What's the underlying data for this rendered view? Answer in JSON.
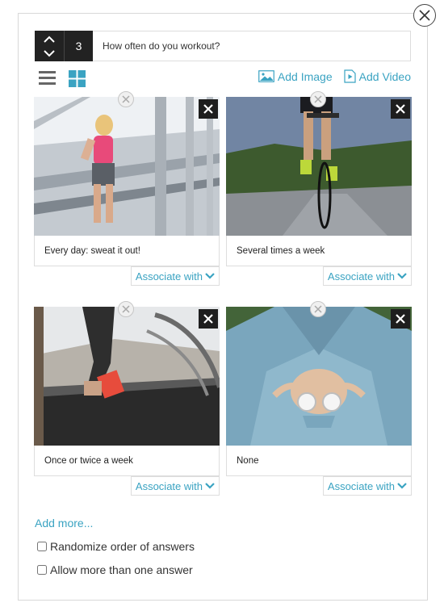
{
  "question": {
    "number": "3",
    "text": "How often do you workout?"
  },
  "toolbar": {
    "add_image": "Add Image",
    "add_video": "Add Video"
  },
  "answers": [
    {
      "label": "Every day: sweat it out!",
      "associate": "Associate with"
    },
    {
      "label": "Several times a week",
      "associate": "Associate with"
    },
    {
      "label": "Once or twice a week",
      "associate": "Associate with"
    },
    {
      "label": "None",
      "associate": "Associate with"
    }
  ],
  "footer": {
    "add_more": "Add more...",
    "randomize": "Randomize order of answers",
    "multiple": "Allow more than one answer"
  },
  "colors": {
    "accent": "#3aa3c2",
    "dark": "#222222"
  }
}
